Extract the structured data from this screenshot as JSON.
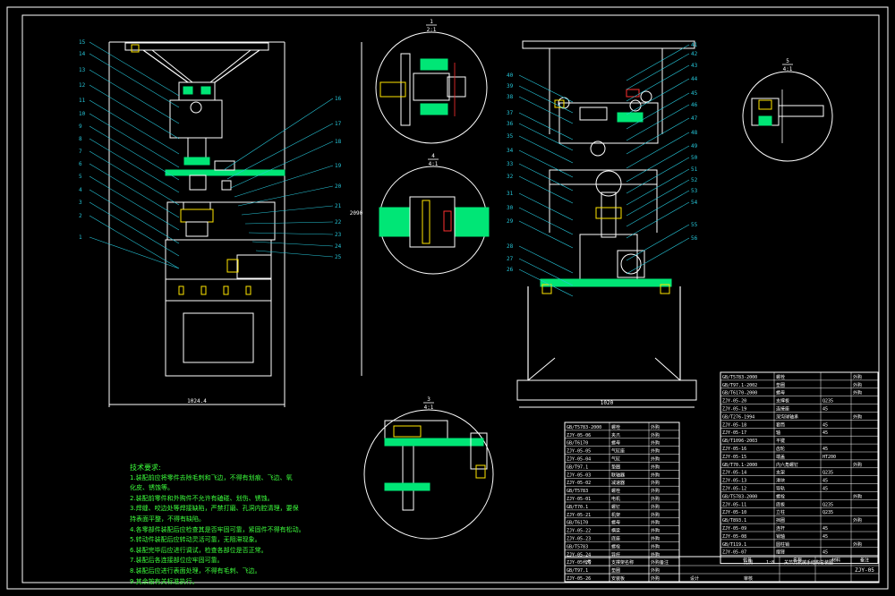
{
  "colors": {
    "background": "#000000",
    "frame": "#ffffff",
    "part": "#ffffff",
    "leader": "#26c6d9",
    "hatch": "#00e676",
    "accent_yellow": "#ffe600",
    "accent_red": "#ff3030",
    "notes_text": "#3cff3c"
  },
  "left_view": {
    "labels": [
      "15",
      "14",
      "13",
      "12",
      "11",
      "10",
      "9",
      "8",
      "7",
      "6",
      "5",
      "4",
      "3",
      "2",
      "1"
    ],
    "right_labels": [
      "16",
      "17",
      "18",
      "19",
      "20",
      "21",
      "22",
      "23",
      "24",
      "25"
    ],
    "width_dim": "1024.4",
    "height_dim": "2090"
  },
  "right_view": {
    "left_labels": [
      "40",
      "39",
      "38",
      "37",
      "36",
      "35",
      "34",
      "33",
      "32",
      "31",
      "30",
      "29",
      "28",
      "27",
      "26"
    ],
    "right_labels": [
      "41",
      "42",
      "43",
      "44",
      "45",
      "46",
      "47",
      "48",
      "49",
      "50",
      "51",
      "52",
      "53",
      "54",
      "55",
      "56"
    ],
    "width_dim": "1020"
  },
  "details": {
    "top": {
      "num": "1",
      "den": "2:1"
    },
    "mid": {
      "num": "4",
      "den": "4:1"
    },
    "bottom": {
      "num": "3",
      "den": "4:1"
    },
    "right": {
      "num": "5",
      "den": "4:1"
    }
  },
  "notes": {
    "heading": "技术要求:",
    "items": [
      "1.装配前应将零件去除毛刺和飞边，不得有划痕、飞边、氧",
      "  化皮、锈蚀等。",
      "2.装配前零件和外购件不允许有磕碰、划伤、锈蚀。",
      "3.焊缝、咬边处等焊接缺陷，严禁打磨、孔洞内腔清理，要保",
      "  持表面平整，不得有缺陷。",
      "4.各零部件装配后应检查其是否牢固可靠，紧固件不得有松动。",
      "5.转动件装配后应转动灵活可靠，无阻滞现象。",
      "6.装配完毕后应进行调试，检查各部位是否正常。",
      "7.装配后各连接部位应牢固可靠。",
      "8.装配后应进行表面处理，不得有毛刺、飞边。",
      "9.其余按有关标准执行。"
    ]
  },
  "bom_right": {
    "header": [
      "代号",
      "名称",
      "材料",
      "备注"
    ],
    "rows": [
      [
        "GB/T5783-2000",
        "螺栓",
        "",
        "外购"
      ],
      [
        "GB/T97.1-2002",
        "垫圈",
        "",
        "外购"
      ],
      [
        "GB/T6170-2000",
        "螺母",
        "",
        "外购"
      ],
      [
        "ZJY-05-20",
        "支撑板",
        "Q235",
        ""
      ],
      [
        "ZJY-05-19",
        "连接座",
        "45",
        ""
      ],
      [
        "GB/T276-1994",
        "深沟球轴承",
        "",
        "外购"
      ],
      [
        "ZJY-05-18",
        "套筒",
        "45",
        ""
      ],
      [
        "ZJY-05-17",
        "轴",
        "45",
        ""
      ],
      [
        "GB/T1096-2003",
        "平键",
        "",
        ""
      ],
      [
        "ZJY-05-16",
        "齿轮",
        "45",
        ""
      ],
      [
        "ZJY-05-15",
        "端盖",
        "HT200",
        ""
      ],
      [
        "GB/T70.1-2000",
        "内六角螺钉",
        "",
        "外购"
      ],
      [
        "ZJY-05-14",
        "支架",
        "Q235",
        ""
      ],
      [
        "ZJY-05-13",
        "滑块",
        "45",
        ""
      ],
      [
        "ZJY-05-12",
        "导轨",
        "45",
        ""
      ],
      [
        "GB/T5783-2000",
        "螺栓",
        "",
        "外购"
      ],
      [
        "ZJY-05-11",
        "底板",
        "Q235",
        ""
      ],
      [
        "ZJY-05-10",
        "立柱",
        "Q235",
        ""
      ],
      [
        "GB/T893.1",
        "挡圈",
        "",
        "外购"
      ],
      [
        "ZJY-05-09",
        "连杆",
        "45",
        ""
      ],
      [
        "ZJY-05-08",
        "销轴",
        "45",
        ""
      ],
      [
        "GB/T119.1",
        "圆柱销",
        "",
        "外购"
      ],
      [
        "ZJY-05-07",
        "摆臂",
        "45",
        ""
      ]
    ]
  },
  "bom_left": {
    "header": [
      "序号",
      "名称",
      "备注"
    ],
    "rows": [
      [
        "GB/T5783-2000",
        "螺栓",
        "外购"
      ],
      [
        "ZJY-05-06",
        "夹爪",
        "外购"
      ],
      [
        "GB/T6170",
        "螺母",
        "外购"
      ],
      [
        "ZJY-05-05",
        "气缸座",
        "外购"
      ],
      [
        "ZJY-05-04",
        "气缸",
        "外购"
      ],
      [
        "GB/T97.1",
        "垫圈",
        "外购"
      ],
      [
        "ZJY-05-03",
        "联轴器",
        "外购"
      ],
      [
        "ZJY-05-02",
        "减速器",
        "外购"
      ],
      [
        "GB/T5783",
        "螺栓",
        "外购"
      ],
      [
        "ZJY-05-01",
        "电机",
        "外购"
      ],
      [
        "GB/T70.1",
        "螺钉",
        "外购"
      ],
      [
        "ZJY-05-21",
        "机架",
        "外购"
      ],
      [
        "GB/T6170",
        "螺母",
        "外购"
      ],
      [
        "ZJY-05-22",
        "横梁",
        "外购"
      ],
      [
        "ZJY-05-23",
        "底座",
        "外购"
      ],
      [
        "GB/T5783",
        "螺栓",
        "外购"
      ],
      [
        "ZJY-05-24",
        "导杆",
        "外购"
      ],
      [
        "ZJY-05-25",
        "支撑架",
        "外购"
      ],
      [
        "GB/T97.1",
        "垫圈",
        "外购"
      ],
      [
        "ZJY-05-26",
        "安装板",
        "外购"
      ]
    ]
  },
  "title_block": {
    "header_left": [
      "代号",
      "名称",
      "备注"
    ],
    "scale_label": "比例",
    "scale_value": "1:8",
    "title": "关节式机械手结构总装图",
    "drawing_no": "ZJY-05",
    "design_label": "设计",
    "check_label": "审核"
  }
}
